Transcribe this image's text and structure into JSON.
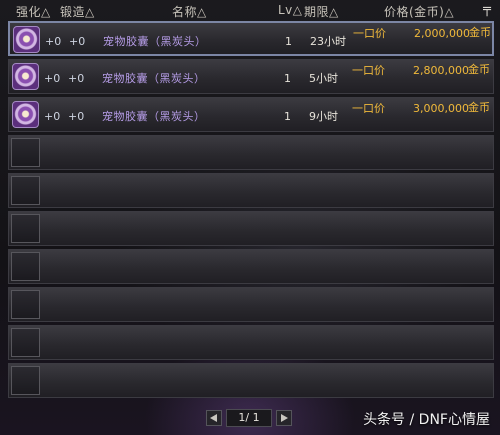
{
  "columns": {
    "enhance": "强化△",
    "forge": "锻造△",
    "name": "名称△",
    "lv": "Lv△",
    "duration": "期限△",
    "price": "价格(金币)△"
  },
  "pin_icon": "pin-icon",
  "listings": [
    {
      "icon": "pet-capsule-icon",
      "enhance": "+0",
      "forge": "+0",
      "name": "宠物胶囊（黑炭头）",
      "lv": "1",
      "duration": "23小时",
      "price_type": "一口价",
      "price": "2,000,000",
      "currency": "金币",
      "selected": true
    },
    {
      "icon": "pet-capsule-icon",
      "enhance": "+0",
      "forge": "+0",
      "name": "宠物胶囊（黑炭头）",
      "lv": "1",
      "duration": "5小时",
      "price_type": "一口价",
      "price": "2,800,000",
      "currency": "金币",
      "selected": false
    },
    {
      "icon": "pet-capsule-icon",
      "enhance": "+0",
      "forge": "+0",
      "name": "宠物胶囊（黑炭头）",
      "lv": "1",
      "duration": "9小时",
      "price_type": "一口价",
      "price": "3,000,000",
      "currency": "金币",
      "selected": false
    }
  ],
  "pagination": {
    "page_text": "1/ 1",
    "prev_icon": "triangle-left-icon",
    "next_icon": "triangle-right-icon"
  },
  "watermark": "头条号 / DNF心情屋",
  "colors": {
    "price_gold": "#f0b93a",
    "item_name_purple": "#b59ce6",
    "selected_border": "#7c86a5"
  }
}
